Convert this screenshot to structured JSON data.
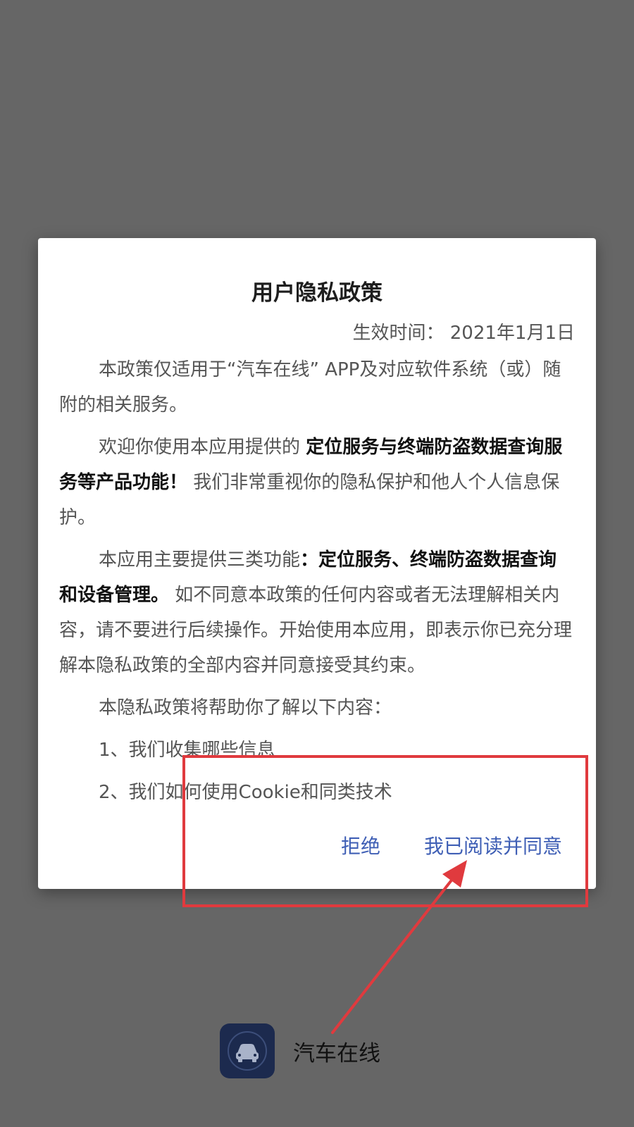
{
  "dialog": {
    "title": "用户隐私政策",
    "effective_date": "生效时间： 2021年1月1日",
    "paragraphs": {
      "p1": "本政策仅适用于“汽车在线” APP及对应软件系统（或）随附的相关服务。",
      "p2_a": "欢迎你使用本应用提供的 ",
      "p2_b": "定位服务与终端防盗数据查询服务等产品功能！",
      "p2_c": " 我们非常重视你的隐私保护和他人个人信息保护。",
      "p3_a": "本应用主要提供三类功能",
      "p3_b": "：定位服务、终端防盗数据查询和设备管理。",
      "p3_c": " 如不同意本政策的任何内容或者无法理解相关内容，请不要进行后续操作。开始使用本应用，即表示你已充分理解本隐私政策的全部内容并同意接受其约束。",
      "p4": "本隐私政策将帮助你了解以下内容：",
      "item1": "1、我们收集哪些信息",
      "item2": "2、我们如何使用Cookie和同类技术"
    },
    "buttons": {
      "reject": "拒绝",
      "agree": "我已阅读并同意"
    }
  },
  "app": {
    "name": "汽车在线",
    "icon": "car-icon"
  },
  "colors": {
    "overlay": "#666666",
    "button_text": "#3f5fb5",
    "annotation": "#e03a3e",
    "app_icon_bg": "#1c2a4e"
  }
}
